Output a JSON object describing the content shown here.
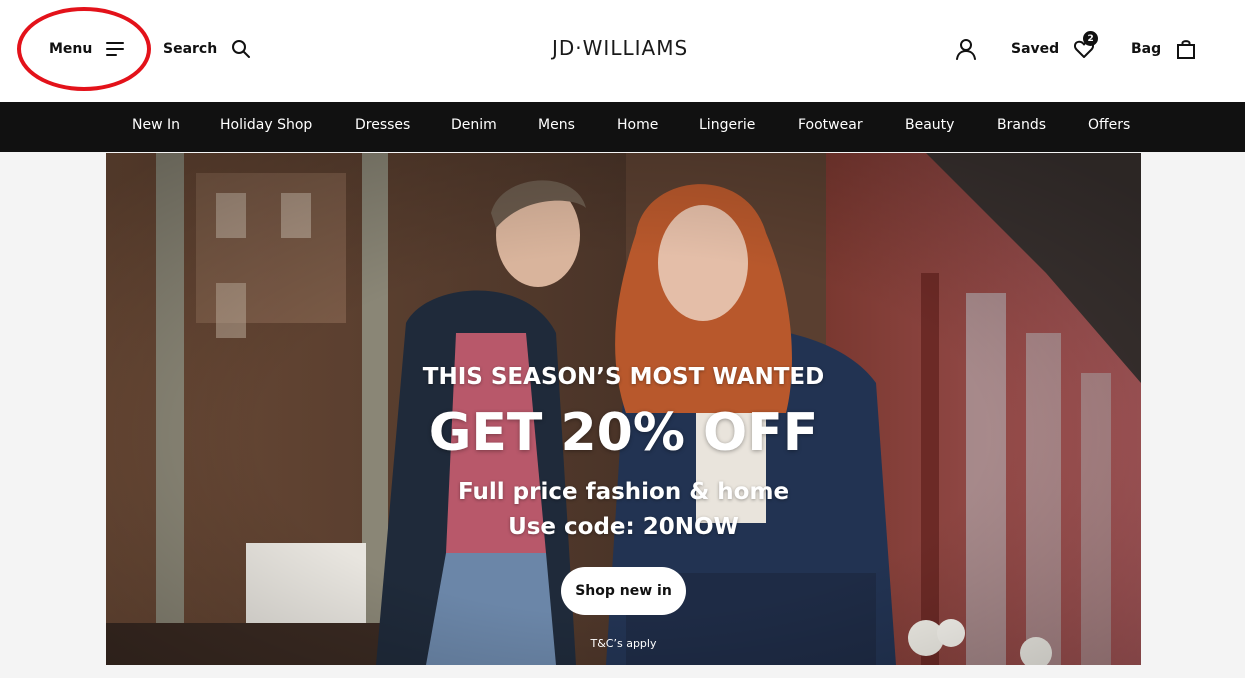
{
  "header": {
    "menu_label": "Menu",
    "search_label": "Search",
    "logo_text": "JD·WILLIAMS",
    "saved_label": "Saved",
    "saved_count": "2",
    "bag_label": "Bag"
  },
  "nav": {
    "items": [
      "New In",
      "Holiday Shop",
      "Dresses",
      "Denim",
      "Mens",
      "Home",
      "Lingerie",
      "Footwear",
      "Beauty",
      "Brands",
      "Offers"
    ]
  },
  "hero": {
    "eyebrow": "THIS SEASON’S MOST WANTED",
    "headline": "GET 20% OFF",
    "subline": "Full price fashion & home",
    "code_line": "Use code: 20NOW",
    "cta_label": "Shop new in",
    "terms": "T&C’s apply"
  },
  "annotation": {
    "color": "#e3121a"
  },
  "colors": {
    "nav_background": "#111111",
    "header_background": "#ffffff"
  },
  "icons": {
    "menu": "hamburger-icon",
    "search": "search-icon",
    "account": "user-icon",
    "saved": "heart-icon",
    "bag": "bag-icon"
  }
}
